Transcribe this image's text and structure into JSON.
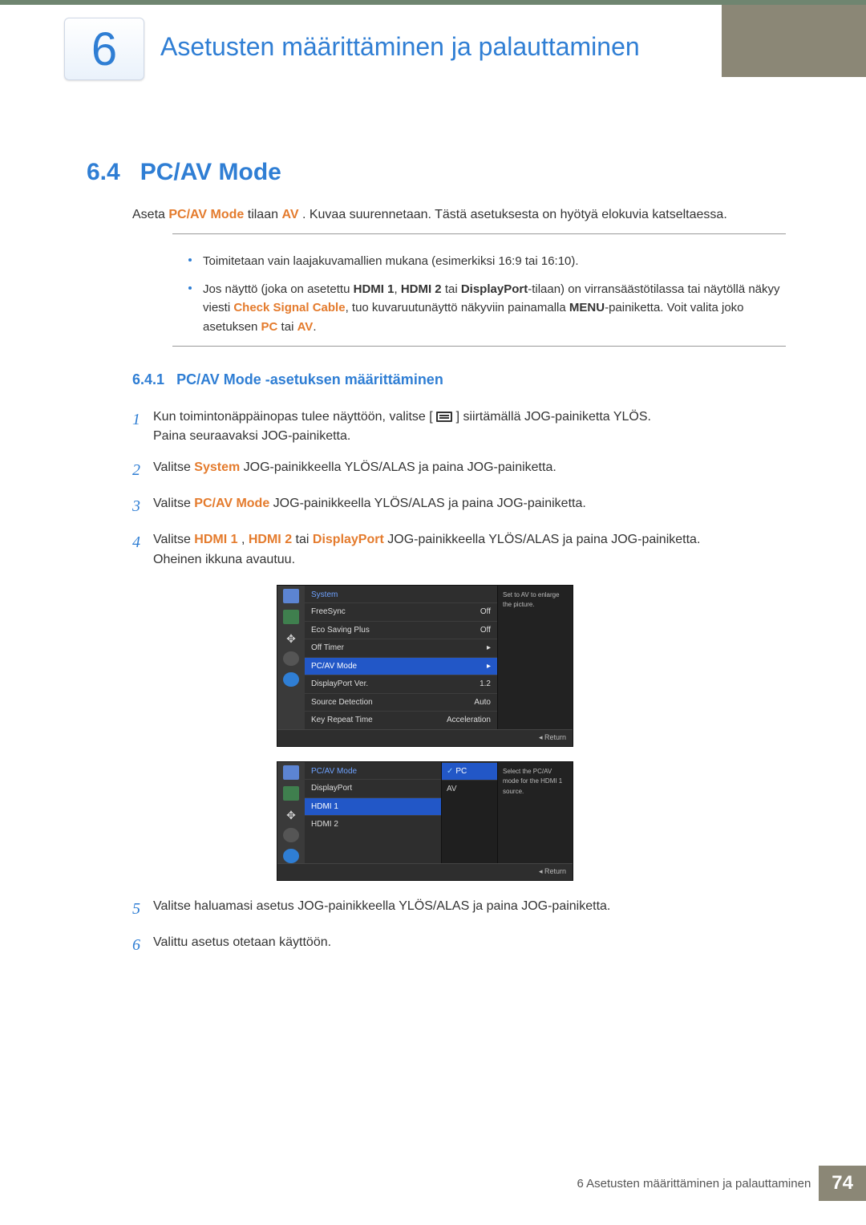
{
  "chapter": {
    "number": "6",
    "title": "Asetusten määrittäminen ja palauttaminen"
  },
  "section": {
    "num": "6.4",
    "title": "PC/AV Mode"
  },
  "intro": {
    "prefix": "Aseta ",
    "pcav": "PC/AV Mode",
    "mid": " tilaan ",
    "av": "AV",
    "suffix": ". Kuvaa suurennetaan. Tästä asetuksesta on hyötyä elokuvia katseltaessa."
  },
  "bullets": [
    {
      "text": "Toimitetaan vain laajakuvamallien mukana (esimerkiksi 16:9 tai 16:10)."
    },
    {
      "parts": [
        "Jos näyttö (joka on asetettu ",
        {
          "bold": "HDMI 1"
        },
        ", ",
        {
          "bold": "HDMI 2"
        },
        " tai ",
        {
          "bold": "DisplayPort"
        },
        "-tilaan) on virransäästötilassa tai näytöllä näkyy viesti ",
        {
          "orange": "Check Signal Cable"
        },
        ", tuo kuvaruutunäyttö näkyviin painamalla ",
        {
          "bold": "MENU"
        },
        "-painiketta. Voit valita joko asetuksen ",
        {
          "orange": "PC"
        },
        " tai ",
        {
          "orange": "AV"
        },
        "."
      ]
    }
  ],
  "subsection": {
    "num": "6.4.1",
    "title": "PC/AV Mode -asetuksen määrittäminen"
  },
  "steps": {
    "1a": "Kun toimintonäppäinopas tulee näyttöön, valitse [",
    "1b": "] siirtämällä JOG-painiketta YLÖS.",
    "1c": "Paina seuraavaksi JOG-painiketta.",
    "2a": "Valitse ",
    "2b": "System",
    "2c": " JOG-painikkeella YLÖS/ALAS ja paina JOG-painiketta.",
    "3a": "Valitse ",
    "3b": "PC/AV Mode",
    "3c": " JOG-painikkeella YLÖS/ALAS ja paina JOG-painiketta.",
    "4a": "Valitse ",
    "4b": "HDMI 1",
    "4c": ", ",
    "4d": "HDMI 2",
    "4e": " tai ",
    "4f": "DisplayPort",
    "4g": " JOG-painikkeella YLÖS/ALAS ja paina JOG-painiketta.",
    "4h": "Oheinen ikkuna avautuu.",
    "5": "Valitse haluamasi asetus JOG-painikkeella YLÖS/ALAS ja paina JOG-painiketta.",
    "6": "Valittu asetus otetaan käyttöön."
  },
  "osd1": {
    "title": "System",
    "help": "Set to AV to enlarge the picture.",
    "rows": [
      {
        "label": "FreeSync",
        "value": "Off"
      },
      {
        "label": "Eco Saving Plus",
        "value": "Off"
      },
      {
        "label": "Off Timer",
        "value": "▸"
      },
      {
        "label": "PC/AV Mode",
        "value": "▸",
        "hl": true
      },
      {
        "label": "DisplayPort Ver.",
        "value": "1.2"
      },
      {
        "label": "Source Detection",
        "value": "Auto"
      },
      {
        "label": "Key Repeat Time",
        "value": "Acceleration"
      }
    ],
    "return": "Return"
  },
  "osd2": {
    "title": "PC/AV Mode",
    "help": "Select the PC/AV mode for the HDMI 1 source.",
    "rows": [
      {
        "label": "DisplayPort"
      },
      {
        "label": "HDMI 1",
        "hl": true
      },
      {
        "label": "HDMI 2"
      }
    ],
    "sub": [
      {
        "label": "PC",
        "hl": true,
        "check": true
      },
      {
        "label": "AV"
      }
    ],
    "return": "Return"
  },
  "footer": {
    "text": "6 Asetusten määrittäminen ja palauttaminen",
    "page": "74"
  }
}
